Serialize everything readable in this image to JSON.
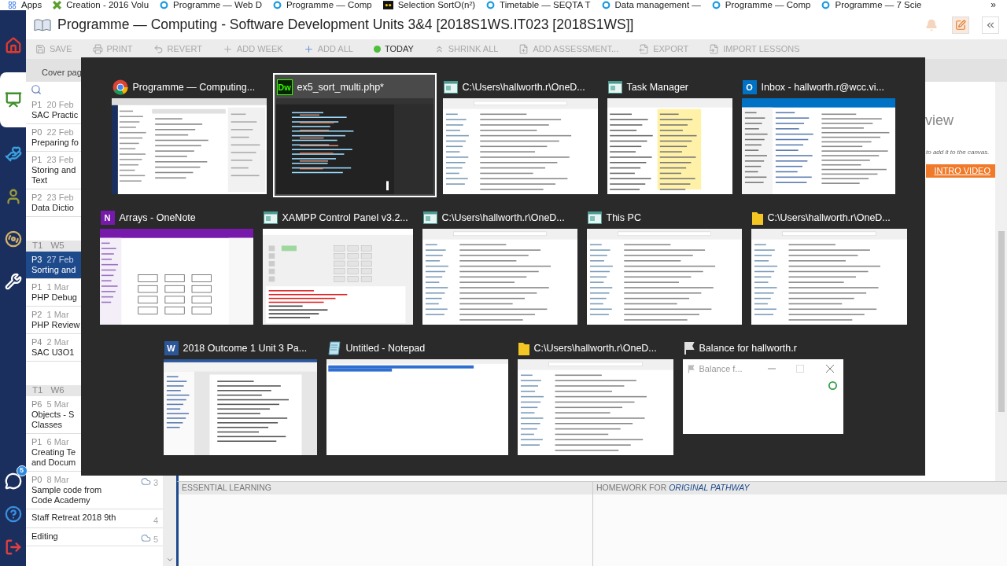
{
  "bookmarks": [
    {
      "kind": "apps",
      "label": "Apps"
    },
    {
      "kind": "creation",
      "label": "Creation - 2016 Volu"
    },
    {
      "kind": "seqta",
      "label": "Programme — Web D"
    },
    {
      "kind": "seqta",
      "label": "Programme — Comp"
    },
    {
      "kind": "video",
      "label": "Selection SortO(n²)"
    },
    {
      "kind": "seqta",
      "label": "Timetable — SEQTA T"
    },
    {
      "kind": "seqta",
      "label": "Data management —"
    },
    {
      "kind": "seqta",
      "label": "Programme — Comp"
    },
    {
      "kind": "seqta",
      "label": "Programme — 7 Scie"
    }
  ],
  "bookmarks_more": "»",
  "nav": {
    "items": [
      {
        "kind": "home",
        "selected": false
      },
      {
        "kind": "chalkboard",
        "selected": true
      },
      {
        "kind": "hands",
        "selected": false
      },
      {
        "kind": "person",
        "selected": false
      },
      {
        "kind": "disc",
        "selected": false
      },
      {
        "kind": "tools",
        "selected": false
      }
    ],
    "bottom": [
      {
        "kind": "chat",
        "badge": "5"
      },
      {
        "kind": "help"
      },
      {
        "kind": "exit"
      }
    ]
  },
  "title": "Programme — Computing - Software Development Units 3&4 [2018S1WS.IT023 [2018S1WS]]",
  "toolbar": [
    {
      "label": "SAVE",
      "disabled": true
    },
    {
      "label": "PRINT",
      "disabled": true
    },
    {
      "label": "REVERT",
      "disabled": true
    },
    {
      "label": "ADD WEEK",
      "disabled": true
    },
    {
      "label": "ADD ALL",
      "disabled": true
    },
    {
      "label": "TODAY",
      "disabled": false
    },
    {
      "label": "SHRINK ALL",
      "disabled": true
    },
    {
      "label": "ADD ASSESSMENT...",
      "disabled": true
    },
    {
      "label": "EXPORT",
      "disabled": true
    },
    {
      "label": "IMPORT LESSONS",
      "disabled": true
    }
  ],
  "tabs": [
    {
      "label": "Cover pag"
    }
  ],
  "lessons": {
    "items": [
      {
        "kind": "lesson",
        "period": "P1",
        "date": "20 Feb",
        "lines": [
          "SAC Practic"
        ],
        "selected": false
      },
      {
        "kind": "lesson",
        "period": "P0",
        "date": "22 Feb",
        "lines": [
          "Preparing fo"
        ],
        "selected": false
      },
      {
        "kind": "lesson",
        "period": "P1",
        "date": "23 Feb",
        "lines": [
          "Storing and",
          "Text"
        ],
        "selected": false
      },
      {
        "kind": "lesson",
        "period": "P2",
        "date": "23 Feb",
        "lines": [
          "Data Dictio"
        ],
        "selected": false
      },
      {
        "kind": "week",
        "term": "T1",
        "week": "W5"
      },
      {
        "kind": "lesson",
        "period": "P3",
        "date": "27 Feb",
        "lines": [
          "Sorting and"
        ],
        "selected": true
      },
      {
        "kind": "lesson",
        "period": "P1",
        "date": "1 Mar",
        "lines": [
          "PHP Debug"
        ],
        "selected": false
      },
      {
        "kind": "lesson",
        "period": "P2",
        "date": "1 Mar",
        "lines": [
          "PHP Review"
        ],
        "selected": false
      },
      {
        "kind": "lesson",
        "period": "P4",
        "date": "2 Mar",
        "lines": [
          "SAC U3O1"
        ],
        "selected": false
      },
      {
        "kind": "week",
        "term": "T1",
        "week": "W6"
      },
      {
        "kind": "lesson",
        "period": "P6",
        "date": "5 Mar",
        "lines": [
          "Objects - S",
          "Classes"
        ],
        "selected": false
      },
      {
        "kind": "lesson",
        "period": "P1",
        "date": "6 Mar",
        "lines": [
          "Creating Te",
          "and Docum"
        ],
        "selected": false
      },
      {
        "kind": "lesson",
        "period": "P0",
        "date": "8 Mar",
        "lines": [
          "Sample code from",
          "Code Academy"
        ],
        "selected": false,
        "synced": true,
        "count": "3"
      },
      {
        "kind": "lesson",
        "lines": [
          "Staff Retreat 2018 9th"
        ],
        "selected": false,
        "count": "4"
      },
      {
        "kind": "lesson",
        "lines": [
          "Editing"
        ],
        "selected": false,
        "synced": true,
        "count": "5"
      }
    ]
  },
  "side_panel": {
    "heading": "view",
    "hint": "to add it to the canvas.",
    "video_banner": {
      "link": "INTRO VIDEO"
    }
  },
  "bottom_panels": [
    {
      "label": "ESSENTIAL LEARNING"
    },
    {
      "label": "HOMEWORK FOR ",
      "emphasis": "ORIGINAL PATHWAY"
    }
  ],
  "task_switcher": {
    "rows": [
      {
        "windows": [
          {
            "kind": "browser",
            "title": "Programme — Computing...",
            "selected": false
          },
          {
            "kind": "dreamweaver",
            "logo": "Dw",
            "title": "ex5_sort_multi.php*",
            "selected": true
          },
          {
            "kind": "explorer",
            "title": "C:\\Users\\hallworth.r\\OneD...",
            "selected": false
          },
          {
            "kind": "taskmanager",
            "title": "Task Manager",
            "selected": false
          },
          {
            "kind": "outlook",
            "logo": "O",
            "title": "Inbox - hallworth.r@wcc.vi...",
            "selected": false
          }
        ]
      },
      {
        "windows": [
          {
            "kind": "onenote",
            "logo": "N",
            "title": "Arrays - OneNote",
            "selected": false
          },
          {
            "kind": "xampp",
            "title": "XAMPP Control Panel v3.2...",
            "selected": false
          },
          {
            "kind": "explorer",
            "title": "C:\\Users\\hallworth.r\\OneD...",
            "selected": false
          },
          {
            "kind": "explorer",
            "title": "This PC",
            "selected": false
          },
          {
            "kind": "folder",
            "title": "C:\\Users\\hallworth.r\\OneD...",
            "selected": false
          }
        ]
      },
      {
        "windows": [
          {
            "kind": "word",
            "logo": "W",
            "title": "2018 Outcome 1 Unit 3 Pa...",
            "selected": false
          },
          {
            "kind": "notepad",
            "title": "Untitled - Notepad",
            "selected": false
          },
          {
            "kind": "folder",
            "title": "C:\\Users\\hallworth.r\\OneD...",
            "selected": false
          },
          {
            "kind": "dialog",
            "title": "Balance for hallworth.r",
            "preview_title": "Balance f...",
            "selected": false
          }
        ]
      }
    ]
  }
}
